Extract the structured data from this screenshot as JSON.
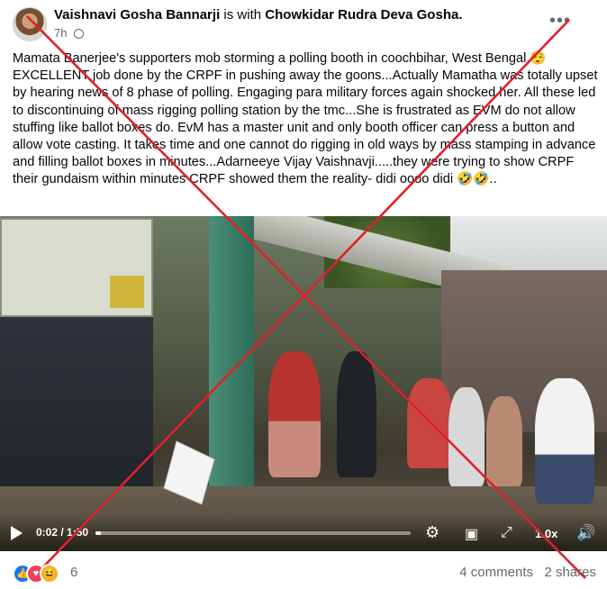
{
  "post": {
    "author": "Vaishnavi Gosha Bannarji",
    "with_text": "is with",
    "tagged": "Chowkidar Rudra Deva Gosha.",
    "time": "7h",
    "text": "Mamata Banerjee's supporters mob storming a polling booth in coochbihar, West Bengal.😌 EXCELLENT job done by the CRPF in pushing away the goons...Actually Mamatha was totally upset by hearing news of 8 phase of polling. Engaging para military forces again shocked her. All these led to discontinuing of mass rigging polling station by the tmc...She is frustrated as EVM do not allow stuffing like ballot boxes do. EvM has a master unit and only booth officer can press a button and allow vote casting. It takes time and one cannot do rigging in old ways by mass stamping in advance and filling ballot boxes in minutes...Adarneeye Vijay Vaishnavji.....they were trying to show CRPF their gundaism within minutes CRPF showed them the reality- didi oooo didi 🤣🤣.."
  },
  "video": {
    "current_time": "0:02",
    "duration": "1:50",
    "time_display": "0:02 / 1:50",
    "progress_fraction": 0.018,
    "speed": "1.0x"
  },
  "footer": {
    "reaction_count": "6",
    "comments": "4 comments",
    "shares": "2 shares"
  },
  "icons": [
    "globe-icon",
    "more-options-icon",
    "play-icon",
    "settings-icon",
    "miniplayer-icon",
    "fullscreen-icon",
    "volume-icon",
    "like-icon",
    "love-icon",
    "haha-icon"
  ],
  "colors": {
    "overlay_x": "#e0202b",
    "like": "#1877f2",
    "love": "#f33e58",
    "haha": "#f7b125"
  }
}
